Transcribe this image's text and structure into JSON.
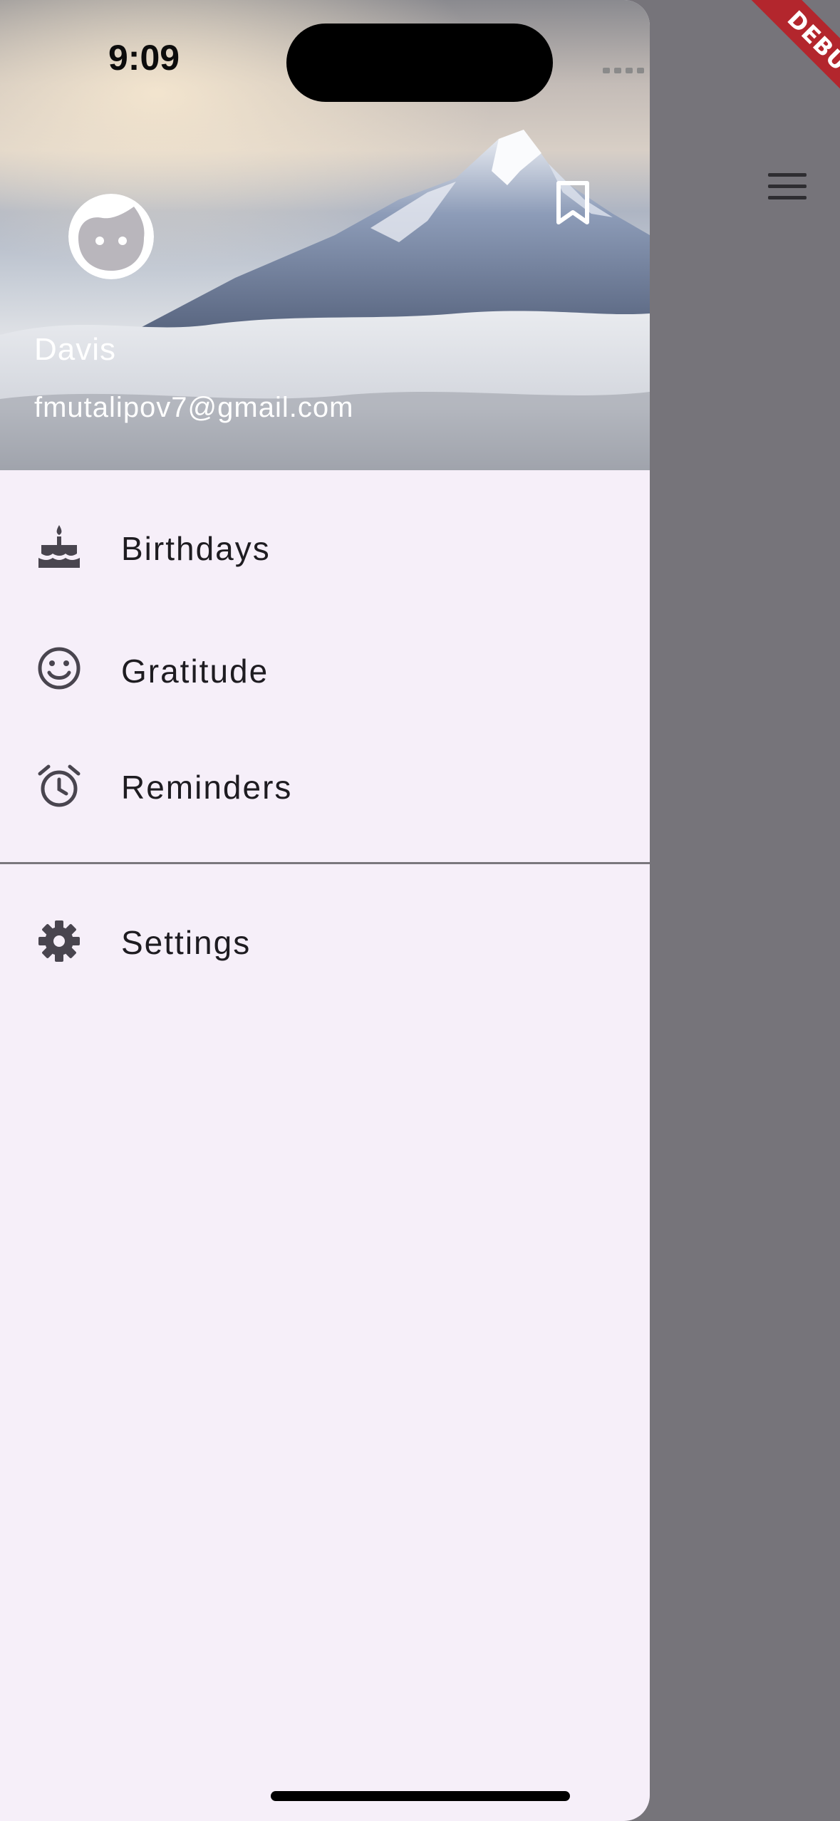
{
  "status_bar": {
    "time": "9:09"
  },
  "debug_banner": {
    "label": "DEBUG"
  },
  "drawer": {
    "header": {
      "name": "Davis",
      "email": "fmutalipov7@gmail.com"
    },
    "items": [
      {
        "label": "Birthdays",
        "icon": "cake-icon"
      },
      {
        "label": "Gratitude",
        "icon": "smiley-icon"
      },
      {
        "label": "Reminders",
        "icon": "alarm-icon"
      }
    ],
    "footer_items": [
      {
        "label": "Settings",
        "icon": "gear-icon"
      }
    ]
  },
  "colors": {
    "drawer_background": "#f6eff9",
    "scrim": "#76747a",
    "icon": "#49454f",
    "debug": "#b3262d"
  }
}
